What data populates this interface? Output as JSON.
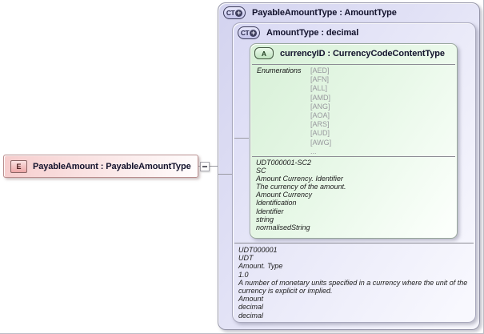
{
  "element_box": {
    "icon_label": "E",
    "title": "PayableAmount : PayableAmountType"
  },
  "collapse_handle": {
    "state": "collapsed-to-minus"
  },
  "outer_type_box": {
    "icon_label": "CT",
    "icon_plus": "+",
    "title": "PayableAmountType : AmountType"
  },
  "inner_type_box": {
    "icon_label": "CT",
    "icon_plus": "+",
    "title": "AmountType : decimal",
    "annotation_lines": [
      "UDT000001",
      "UDT",
      "Amount. Type",
      "1.0",
      "A number of monetary units specified in a currency where the unit of the",
      "currency is explicit or implied.",
      "Amount",
      "decimal",
      "decimal"
    ]
  },
  "attribute_box": {
    "icon_label": "A",
    "title": "currencyID : CurrencyCodeContentType",
    "enumerations_label": "Enumerations",
    "enumeration_values": [
      "[AED]",
      "[AFN]",
      "[ALL]",
      "[AMD]",
      "[ANG]",
      "[AOA]",
      "[ARS]",
      "[AUD]",
      "[AWG]",
      "..."
    ],
    "annotation_lines": [
      "UDT000001-SC2",
      "SC",
      "Amount Currency. Identifier",
      "The currency of the amount.",
      "Amount Currency",
      "Identification",
      "Identifier",
      "string",
      "normalisedString"
    ]
  },
  "colors": {
    "lavender_fill": "#dcdcf4",
    "green_fill": "#ddf2dd",
    "pink_fill": "#f6cdcd",
    "box_border": "#9595a8",
    "connector": "#9a9aa2",
    "title_text": "#12122c",
    "enum_text": "#98989e"
  }
}
